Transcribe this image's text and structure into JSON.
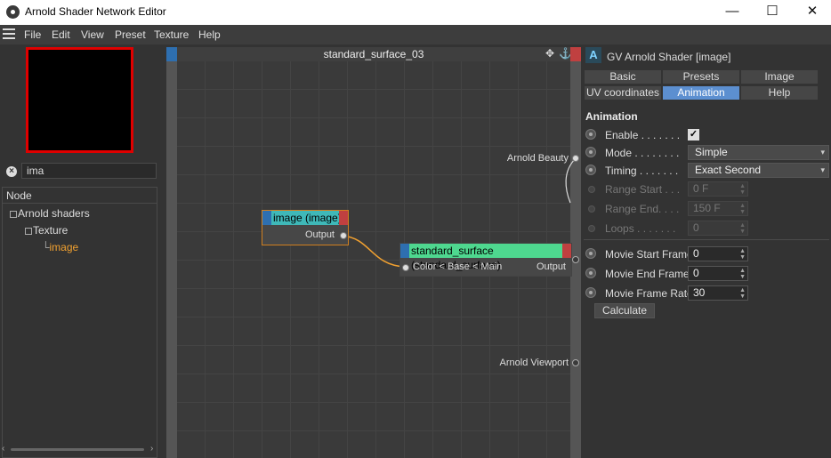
{
  "window": {
    "title": "Arnold Shader Network Editor",
    "minimize": "—",
    "maximize": "☐",
    "close": "✕"
  },
  "menu": [
    "File",
    "Edit",
    "View",
    "Preset",
    "Texture",
    "Help"
  ],
  "search": {
    "value": "ima"
  },
  "tree": {
    "header": "Node",
    "items": [
      "Arnold shaders",
      "Texture",
      "image"
    ]
  },
  "canvas": {
    "title": "standard_surface_03",
    "nodes": {
      "image": {
        "title": "image (image)",
        "output": "Output"
      },
      "surface": {
        "title": "standard_surface (standard_surface)",
        "input": "Color < Base < Main",
        "output": "Output"
      }
    },
    "ports": {
      "beauty": "Arnold Beauty",
      "viewport": "Arnold Viewport"
    }
  },
  "panel": {
    "title": "GV Arnold Shader [image]",
    "tabs": [
      "Basic",
      "Presets",
      "Image attributes",
      "UV coordinates",
      "Animation",
      "Help"
    ],
    "active_tab": "Animation",
    "section": "Animation",
    "props": {
      "enable": {
        "label": "Enable . . . . . . .",
        "checked": true
      },
      "mode": {
        "label": "Mode . . . . . . . .",
        "value": "Simple"
      },
      "timing": {
        "label": "Timing . . . . . . .",
        "value": "Exact Second"
      },
      "range_start": {
        "label": "Range Start . . .",
        "value": "0 F"
      },
      "range_end": {
        "label": "Range End. . . .",
        "value": "150 F"
      },
      "loops": {
        "label": "Loops . . . . . . .",
        "value": "0"
      },
      "movie_start": {
        "label": "Movie Start Frame",
        "value": "0"
      },
      "movie_end": {
        "label": "Movie End Frame",
        "value": "0"
      },
      "movie_rate": {
        "label": "Movie Frame Rate",
        "value": "30"
      }
    },
    "calculate": "Calculate"
  },
  "colors": {
    "node_header_image": "#3fb8b8",
    "node_header_surface": "#4ed88f",
    "active_tab": "#5c8fd0",
    "preview_border": "#e00000"
  }
}
